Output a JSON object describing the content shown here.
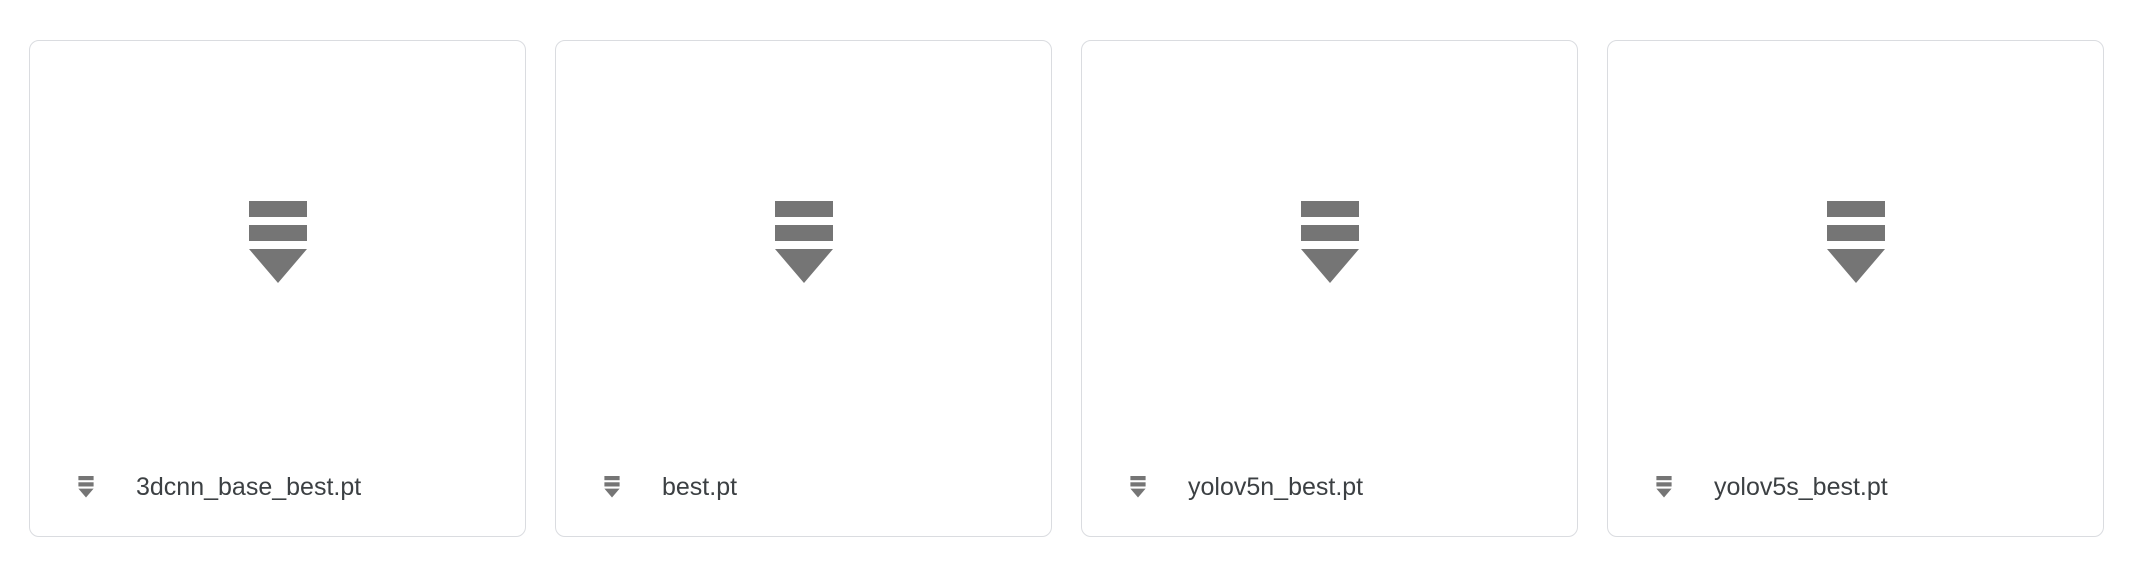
{
  "files": [
    {
      "name": "3dcnn_base_best.pt",
      "icon": "binary-file-icon"
    },
    {
      "name": "best.pt",
      "icon": "binary-file-icon"
    },
    {
      "name": "yolov5n_best.pt",
      "icon": "binary-file-icon"
    },
    {
      "name": "yolov5s_best.pt",
      "icon": "binary-file-icon"
    }
  ],
  "colors": {
    "icon": "#757575",
    "text": "#3c4043",
    "border": "#dadce0"
  }
}
